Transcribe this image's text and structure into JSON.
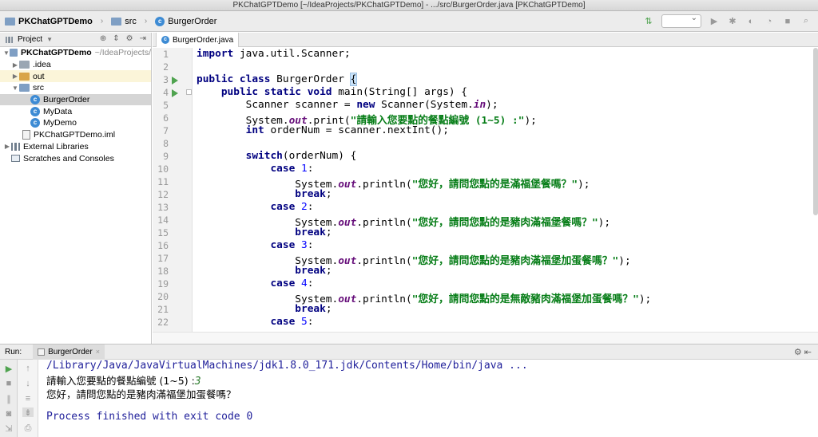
{
  "window": {
    "title": "PKChatGPTDemo [~/IdeaProjects/PKChatGPTDemo] - .../src/BurgerOrder.java [PKChatGPTDemo]"
  },
  "breadcrumb": {
    "project": "PKChatGPTDemo",
    "folder": "src",
    "file": "BurgerOrder"
  },
  "project_panel": {
    "title": "Project",
    "tree": [
      {
        "label": "PKChatGPTDemo",
        "extra": "~/IdeaProjects/",
        "icon": "folder-icon",
        "expanded": true
      },
      {
        "label": ".idea",
        "icon": "folder-icon",
        "expanded": false
      },
      {
        "label": "out",
        "icon": "folder-icon",
        "expanded": false
      },
      {
        "label": "src",
        "icon": "folder-icon",
        "expanded": true
      },
      {
        "label": "BurgerOrder",
        "icon": "class-icon",
        "selected": true
      },
      {
        "label": "MyData",
        "icon": "class-icon"
      },
      {
        "label": "MyDemo",
        "icon": "class-icon"
      },
      {
        "label": "PKChatGPTDemo.iml",
        "icon": "iml-file-icon"
      },
      {
        "label": "External Libraries",
        "icon": "library-icon",
        "expanded": false
      },
      {
        "label": "Scratches and Consoles",
        "icon": "scratches-icon"
      }
    ]
  },
  "editor": {
    "tab_label": "BurgerOrder.java",
    "line_numbers": [
      "1",
      "2",
      "3",
      "4",
      "5",
      "6",
      "7",
      "8",
      "9",
      "10",
      "11",
      "12",
      "13",
      "14",
      "15",
      "16",
      "17",
      "18",
      "19",
      "20",
      "21",
      "22"
    ],
    "code": {
      "l1_kw": "import",
      "l1_rest": " java.util.Scanner;",
      "l3_kw": "public class",
      "l3_name": " BurgerOrder ",
      "l3_brace": "{",
      "l4_kw": "public static void",
      "l4_rest": " main(String[] args) {",
      "l5_a": "Scanner scanner = ",
      "l5_kw": "new",
      "l5_b": " Scanner(System.",
      "l5_fld": "in",
      "l5_c": ");",
      "l6_a": "System.",
      "l6_fld": "out",
      "l6_b": ".print(",
      "l6_str": "\"請輸入您要點的餐點編號 (1~5) :\"",
      "l6_c": ");",
      "l7_kw": "int",
      "l7_rest": " orderNum = scanner.nextInt();",
      "l9_kw": "switch",
      "l9_rest": "(orderNum) {",
      "case_kw": "case",
      "l10_n": " 1",
      "l13_n": " 2",
      "l16_n": " 3",
      "l19_n": " 4",
      "l22_n": " 5",
      "colon": ":",
      "println_a": "System.",
      "println_fld": "out",
      "println_b": ".println(",
      "println_c": ");",
      "break_kw": "break",
      "semicolon": ";",
      "l11_str": "\"您好，請問您點的是滿福堡餐嗎？\"",
      "l14_str": "\"您好，請問您點的是豬肉滿福堡餐嗎？\"",
      "l17_str": "\"您好，請問您點的是豬肉滿福堡加蛋餐嗎？\"",
      "l20_str": "\"您好，請問您點的是無敵豬肉滿福堡加蛋餐嗎？\""
    }
  },
  "run_panel": {
    "label": "Run:",
    "tab_label": "BurgerOrder",
    "console": {
      "cmd": "/Library/Java/JavaVirtualMachines/jdk1.8.0_171.jdk/Contents/Home/bin/java ...",
      "prompt": "請輸入您要點的餐點編號 (1~5) :",
      "input": "3",
      "response": "您好，請問您點的是豬肉滿福堡加蛋餐嗎？",
      "finish": "Process finished with exit code 0"
    }
  },
  "colors": {
    "keyword": "#000080",
    "string": "#067d17",
    "field": "#660e7a",
    "run_green": "#4fa34f"
  }
}
